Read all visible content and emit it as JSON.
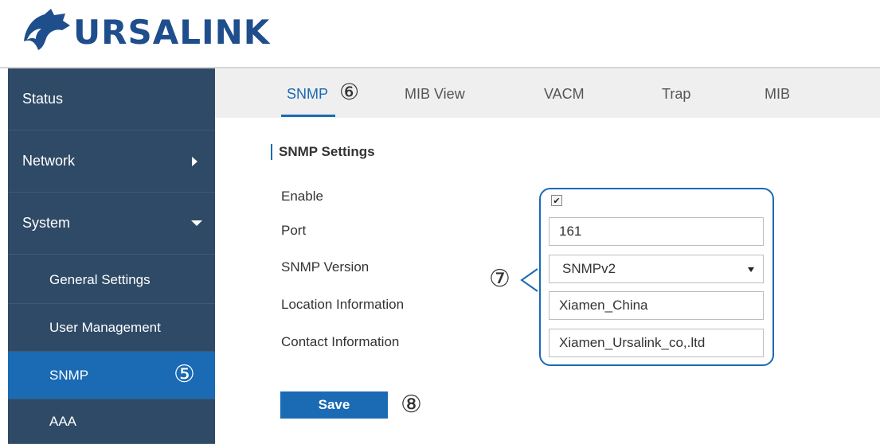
{
  "brand": {
    "name": "URSALINK",
    "color": "#1f4e8c"
  },
  "sidebar": {
    "items": [
      {
        "label": "Status"
      },
      {
        "label": "Network",
        "icon": "chevron-right-icon"
      },
      {
        "label": "System",
        "icon": "chevron-down-icon",
        "expanded": true
      }
    ],
    "sub_items": [
      {
        "label": "General Settings"
      },
      {
        "label": "User Management"
      },
      {
        "label": "SNMP",
        "active": true
      },
      {
        "label": "AAA"
      }
    ]
  },
  "tabs": [
    {
      "label": "SNMP",
      "active": true
    },
    {
      "label": "MIB View"
    },
    {
      "label": "VACM"
    },
    {
      "label": "Trap"
    },
    {
      "label": "MIB"
    }
  ],
  "section_title": "SNMP Settings",
  "form": {
    "enable_label": "Enable",
    "enable_checked": true,
    "enable_mark": "✔",
    "port_label": "Port",
    "port_value": "161",
    "version_label": "SNMP Version",
    "version_value": "SNMPv2",
    "location_label": "Location Information",
    "location_value": "Xiamen_China",
    "contact_label": "Contact Information",
    "contact_value": "Xiamen_Ursalink_co,.ltd"
  },
  "save_label": "Save",
  "callouts": {
    "c5": "⑤",
    "c6": "⑥",
    "c7": "⑦",
    "c8": "⑧"
  },
  "colors": {
    "sidebar_bg": "#2f4a66",
    "accent": "#1a6ab4",
    "tabbar_bg": "#efefef"
  }
}
